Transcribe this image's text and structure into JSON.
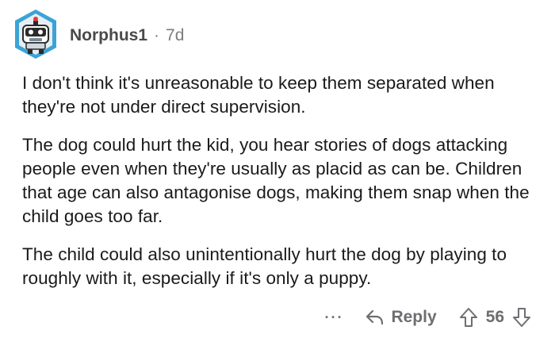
{
  "comment": {
    "author": "Norphus1",
    "separator": "·",
    "age": "7d",
    "paragraphs": [
      "I don't think it's unreasonable to keep them separated when they're not under direct supervision.",
      "The dog could hurt the kid, you hear stories of dogs attacking people even when they're usually as placid as can be. Children that age can also antagonise dogs, making them snap when the child goes too far.",
      "The child could also unintentionally hurt the dog by playing to roughly with it, especially if it's only a puppy."
    ]
  },
  "actions": {
    "more": "···",
    "reply_label": "Reply",
    "score": "56"
  },
  "icons": {
    "avatar": "robot-avatar-icon",
    "reply": "reply-arrow-icon",
    "upvote": "upvote-arrow-icon",
    "downvote": "downvote-arrow-icon"
  },
  "colors": {
    "text": "#1a1a1b",
    "muted": "#6e6e72",
    "avatar_ring": "#2a8fc9"
  }
}
